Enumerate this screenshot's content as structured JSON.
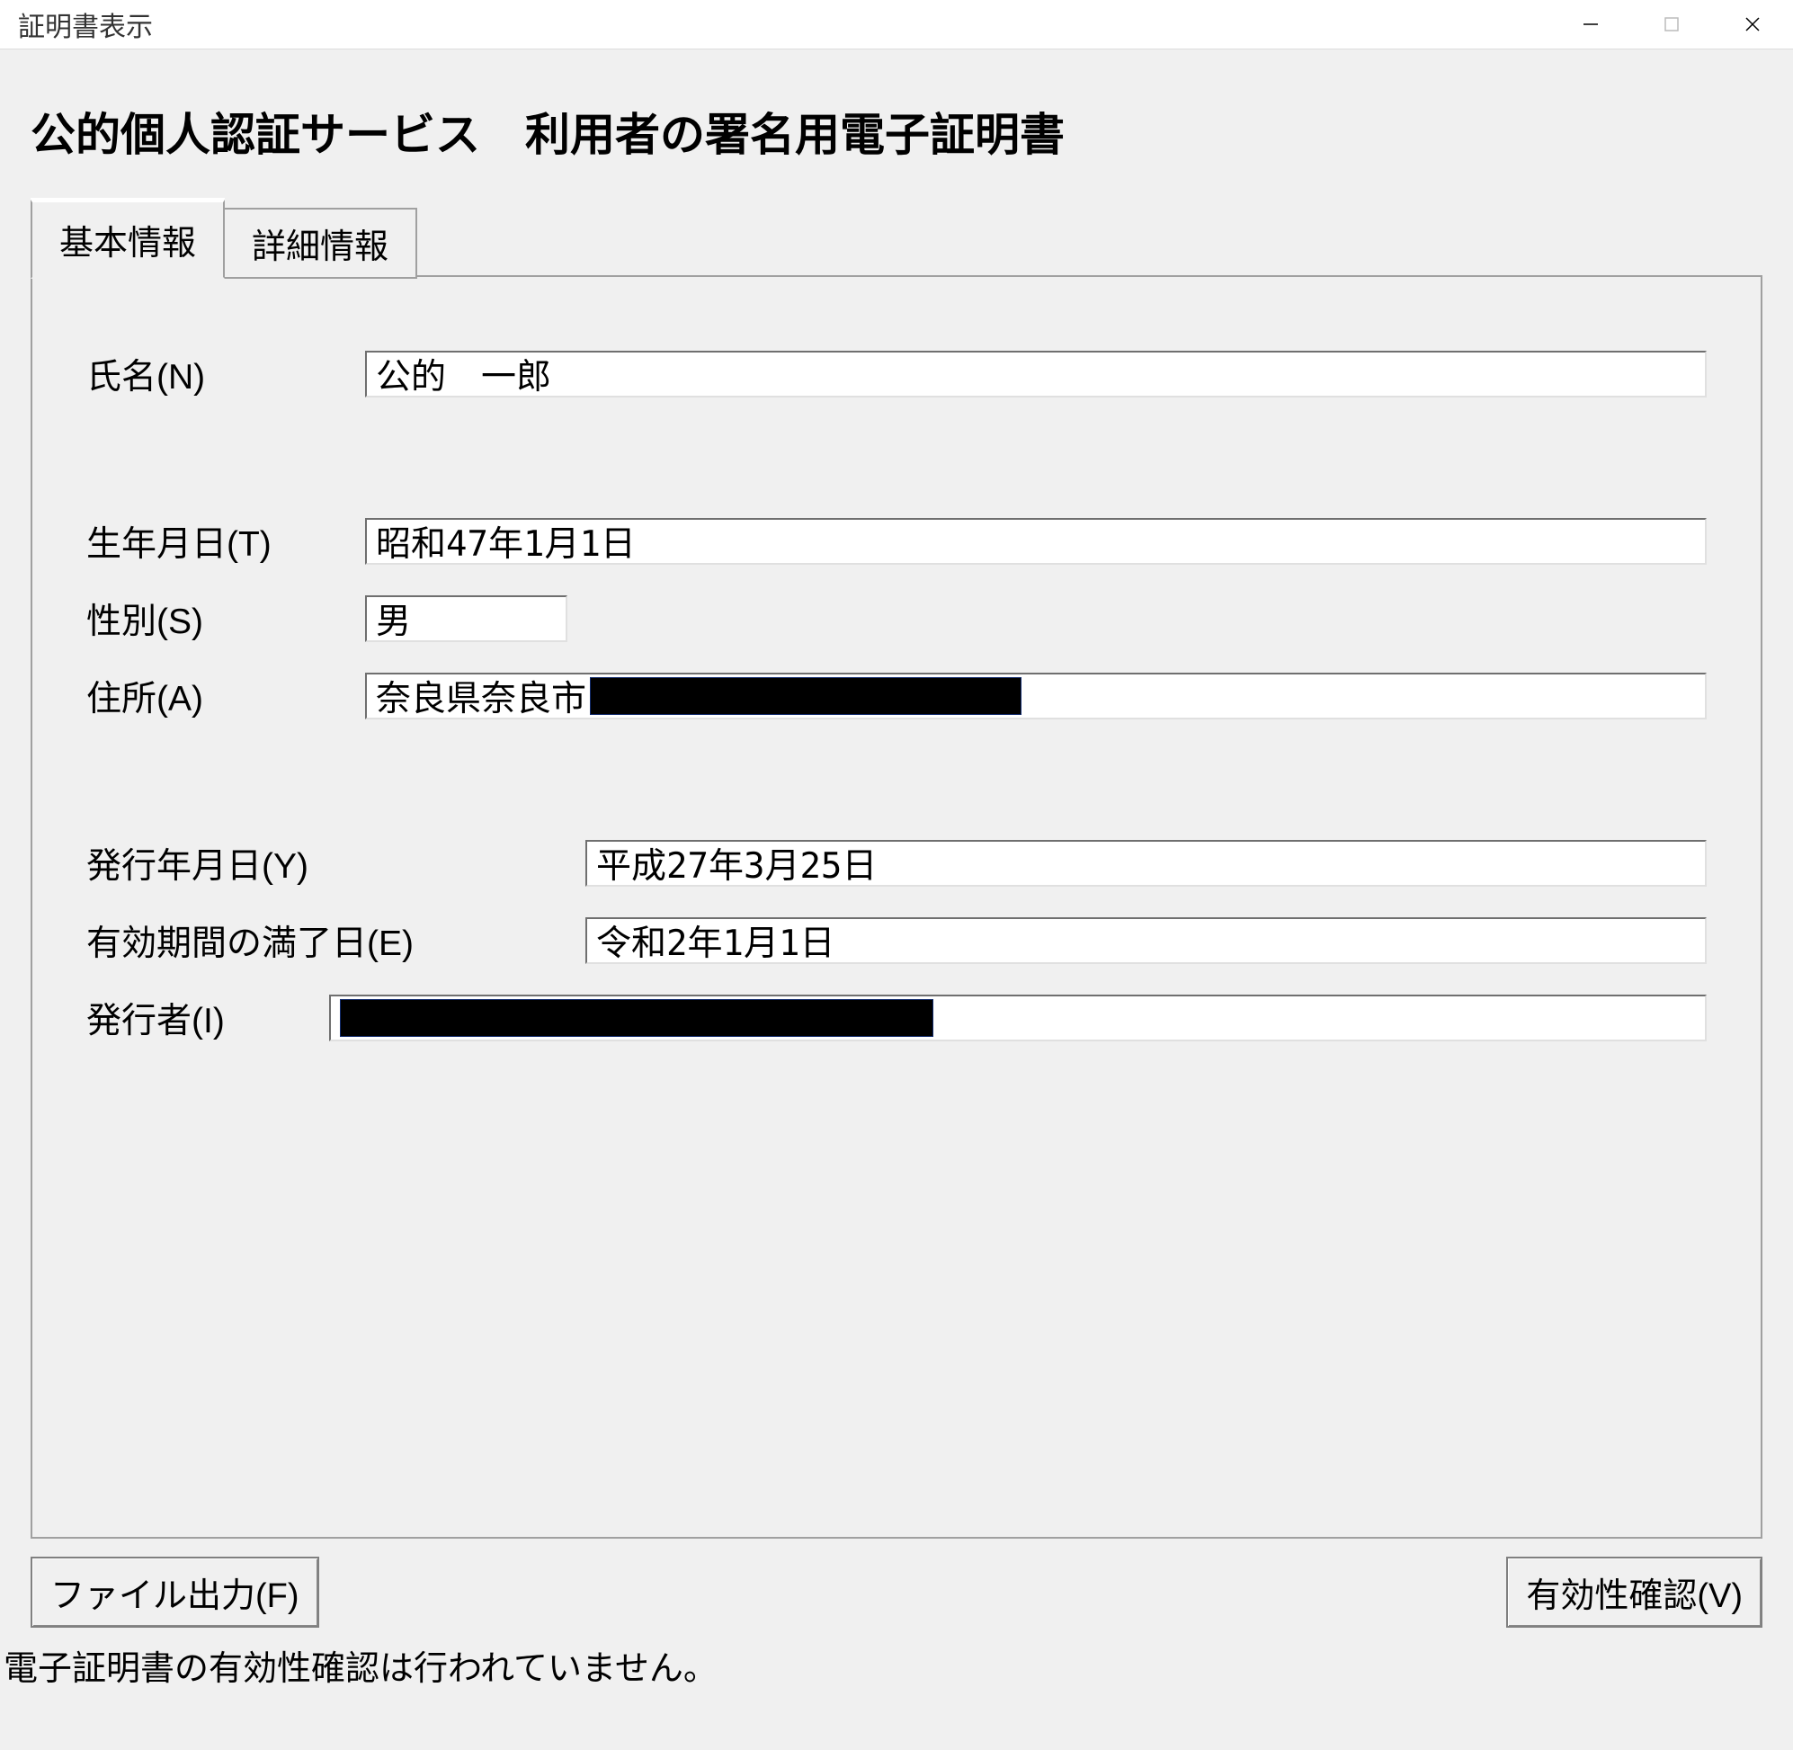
{
  "window": {
    "title": "証明書表示"
  },
  "heading": "公的個人認証サービス　利用者の署名用電子証明書",
  "tabs": {
    "basic": "基本情報",
    "detail": "詳細情報"
  },
  "fields": {
    "name": {
      "label": "氏名(N)",
      "value": "公的　一郎"
    },
    "birthdate": {
      "label": "生年月日(T)",
      "value": "昭和47年1月1日"
    },
    "gender": {
      "label": "性別(S)",
      "value": "男"
    },
    "address": {
      "label": "住所(A)",
      "value_visible": "奈良県奈良市"
    },
    "issue_date": {
      "label": "発行年月日(Y)",
      "value": "平成27年3月25日"
    },
    "expiry_date": {
      "label": "有効期間の満了日(E)",
      "value": "令和2年1月1日"
    },
    "issuer": {
      "label": "発行者(I)"
    }
  },
  "buttons": {
    "file_output": "ファイル出力(F)",
    "validity_check": "有効性確認(V)"
  },
  "status": "電子証明書の有効性確認は行われていません。"
}
